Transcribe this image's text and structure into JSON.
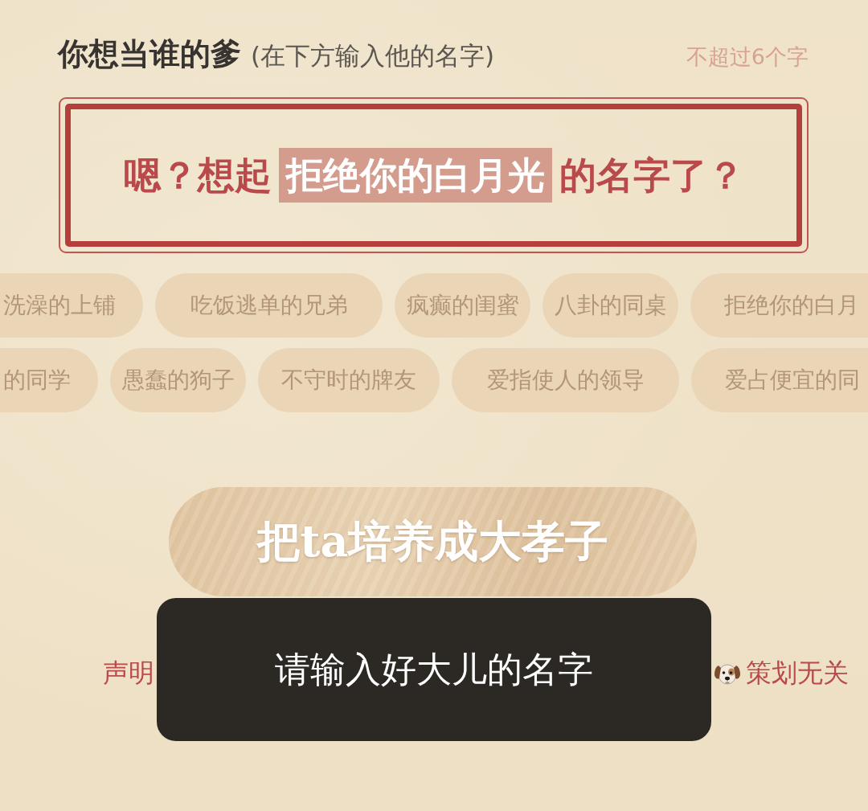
{
  "header": {
    "title": "你想当谁的爹",
    "hint": "(在下方输入他的名字)",
    "limit": "不超过6个字"
  },
  "name_input": {
    "placeholder": [
      {
        "text": "嗯？想起",
        "highlighted": false
      },
      {
        "text": "拒绝你的白月光",
        "highlighted": true
      },
      {
        "text": "的名字了？",
        "highlighted": false
      }
    ]
  },
  "suggestion_rows": [
    [
      "洗澡的上铺",
      "吃饭逃单的兄弟",
      "疯癫的闺蜜",
      "八卦的同桌",
      "拒绝你的白月"
    ],
    [
      "的同学",
      "愚蠢的狗子",
      "不守时的牌友",
      "爱指使人的领导",
      "爱占便宜的同"
    ]
  ],
  "submit_button": {
    "label": "把ta培养成大孝子"
  },
  "disclaimer": {
    "lead": "声明",
    "tail": "策划无关"
  },
  "toast": {
    "message": "请输入好大儿的名字"
  }
}
